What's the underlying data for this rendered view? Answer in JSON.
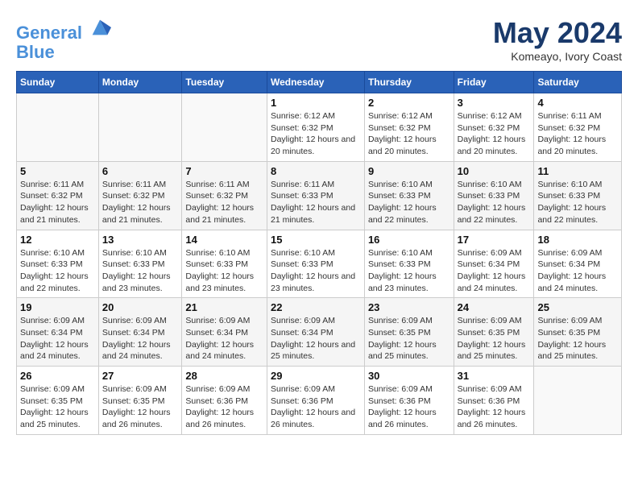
{
  "header": {
    "logo_line1": "General",
    "logo_line2": "Blue",
    "month": "May 2024",
    "location": "Komeayo, Ivory Coast"
  },
  "weekdays": [
    "Sunday",
    "Monday",
    "Tuesday",
    "Wednesday",
    "Thursday",
    "Friday",
    "Saturday"
  ],
  "weeks": [
    [
      {
        "day": "",
        "info": ""
      },
      {
        "day": "",
        "info": ""
      },
      {
        "day": "",
        "info": ""
      },
      {
        "day": "1",
        "info": "Sunrise: 6:12 AM\nSunset: 6:32 PM\nDaylight: 12 hours\nand 20 minutes."
      },
      {
        "day": "2",
        "info": "Sunrise: 6:12 AM\nSunset: 6:32 PM\nDaylight: 12 hours\nand 20 minutes."
      },
      {
        "day": "3",
        "info": "Sunrise: 6:12 AM\nSunset: 6:32 PM\nDaylight: 12 hours\nand 20 minutes."
      },
      {
        "day": "4",
        "info": "Sunrise: 6:11 AM\nSunset: 6:32 PM\nDaylight: 12 hours\nand 20 minutes."
      }
    ],
    [
      {
        "day": "5",
        "info": "Sunrise: 6:11 AM\nSunset: 6:32 PM\nDaylight: 12 hours\nand 21 minutes."
      },
      {
        "day": "6",
        "info": "Sunrise: 6:11 AM\nSunset: 6:32 PM\nDaylight: 12 hours\nand 21 minutes."
      },
      {
        "day": "7",
        "info": "Sunrise: 6:11 AM\nSunset: 6:32 PM\nDaylight: 12 hours\nand 21 minutes."
      },
      {
        "day": "8",
        "info": "Sunrise: 6:11 AM\nSunset: 6:33 PM\nDaylight: 12 hours\nand 21 minutes."
      },
      {
        "day": "9",
        "info": "Sunrise: 6:10 AM\nSunset: 6:33 PM\nDaylight: 12 hours\nand 22 minutes."
      },
      {
        "day": "10",
        "info": "Sunrise: 6:10 AM\nSunset: 6:33 PM\nDaylight: 12 hours\nand 22 minutes."
      },
      {
        "day": "11",
        "info": "Sunrise: 6:10 AM\nSunset: 6:33 PM\nDaylight: 12 hours\nand 22 minutes."
      }
    ],
    [
      {
        "day": "12",
        "info": "Sunrise: 6:10 AM\nSunset: 6:33 PM\nDaylight: 12 hours\nand 22 minutes."
      },
      {
        "day": "13",
        "info": "Sunrise: 6:10 AM\nSunset: 6:33 PM\nDaylight: 12 hours\nand 23 minutes."
      },
      {
        "day": "14",
        "info": "Sunrise: 6:10 AM\nSunset: 6:33 PM\nDaylight: 12 hours\nand 23 minutes."
      },
      {
        "day": "15",
        "info": "Sunrise: 6:10 AM\nSunset: 6:33 PM\nDaylight: 12 hours\nand 23 minutes."
      },
      {
        "day": "16",
        "info": "Sunrise: 6:10 AM\nSunset: 6:33 PM\nDaylight: 12 hours\nand 23 minutes."
      },
      {
        "day": "17",
        "info": "Sunrise: 6:09 AM\nSunset: 6:34 PM\nDaylight: 12 hours\nand 24 minutes."
      },
      {
        "day": "18",
        "info": "Sunrise: 6:09 AM\nSunset: 6:34 PM\nDaylight: 12 hours\nand 24 minutes."
      }
    ],
    [
      {
        "day": "19",
        "info": "Sunrise: 6:09 AM\nSunset: 6:34 PM\nDaylight: 12 hours\nand 24 minutes."
      },
      {
        "day": "20",
        "info": "Sunrise: 6:09 AM\nSunset: 6:34 PM\nDaylight: 12 hours\nand 24 minutes."
      },
      {
        "day": "21",
        "info": "Sunrise: 6:09 AM\nSunset: 6:34 PM\nDaylight: 12 hours\nand 24 minutes."
      },
      {
        "day": "22",
        "info": "Sunrise: 6:09 AM\nSunset: 6:34 PM\nDaylight: 12 hours\nand 25 minutes."
      },
      {
        "day": "23",
        "info": "Sunrise: 6:09 AM\nSunset: 6:35 PM\nDaylight: 12 hours\nand 25 minutes."
      },
      {
        "day": "24",
        "info": "Sunrise: 6:09 AM\nSunset: 6:35 PM\nDaylight: 12 hours\nand 25 minutes."
      },
      {
        "day": "25",
        "info": "Sunrise: 6:09 AM\nSunset: 6:35 PM\nDaylight: 12 hours\nand 25 minutes."
      }
    ],
    [
      {
        "day": "26",
        "info": "Sunrise: 6:09 AM\nSunset: 6:35 PM\nDaylight: 12 hours\nand 25 minutes."
      },
      {
        "day": "27",
        "info": "Sunrise: 6:09 AM\nSunset: 6:35 PM\nDaylight: 12 hours\nand 26 minutes."
      },
      {
        "day": "28",
        "info": "Sunrise: 6:09 AM\nSunset: 6:36 PM\nDaylight: 12 hours\nand 26 minutes."
      },
      {
        "day": "29",
        "info": "Sunrise: 6:09 AM\nSunset: 6:36 PM\nDaylight: 12 hours\nand 26 minutes."
      },
      {
        "day": "30",
        "info": "Sunrise: 6:09 AM\nSunset: 6:36 PM\nDaylight: 12 hours\nand 26 minutes."
      },
      {
        "day": "31",
        "info": "Sunrise: 6:09 AM\nSunset: 6:36 PM\nDaylight: 12 hours\nand 26 minutes."
      },
      {
        "day": "",
        "info": ""
      }
    ]
  ]
}
